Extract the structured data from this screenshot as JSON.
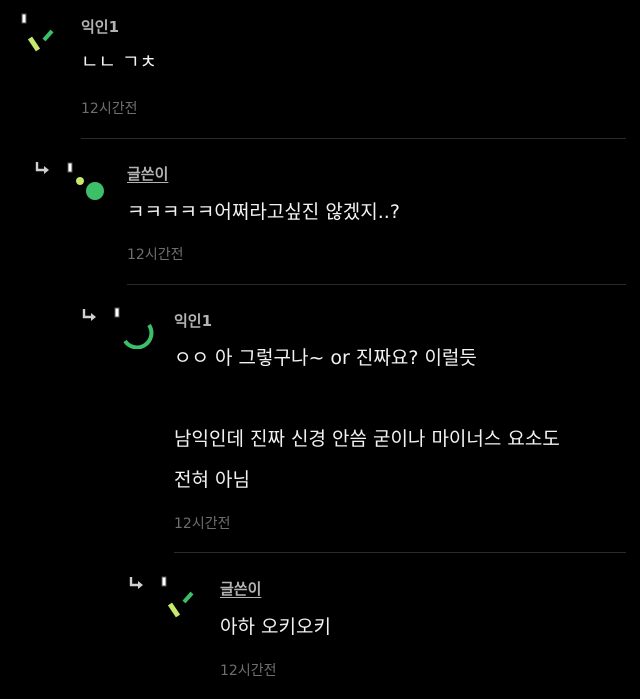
{
  "colors": {
    "background": "#000000",
    "author": "#b3b3b3",
    "body_text": "#f2f2f2",
    "timestamp": "#6e6e6e",
    "divider": "#2a2a2a",
    "avatar_green_light": "#c6e86b",
    "avatar_green": "#3dbf6a"
  },
  "comments": [
    {
      "author": "익인1",
      "body": "ㄴㄴ ㄱㅊ",
      "time": "12시간전",
      "avatar_icon": "slash-shapes-avatar-icon"
    },
    {
      "author": "글쓴이",
      "body": "ㅋㅋㅋㅋㅋ어쩌라고싶진 않겠지..?",
      "time": "12시간전",
      "avatar_icon": "dots-avatar-icon"
    },
    {
      "author": "익인1",
      "body_lines": [
        "ㅇㅇ 아 그렇구나~ or 진짜요? 이럴듯",
        "",
        "남익인데 진짜 신경 안씀 굳이나 마이너스 요소도",
        "전혀 아님"
      ],
      "time": "12시간전",
      "avatar_icon": "arc-avatar-icon"
    },
    {
      "author": "글쓴이",
      "body": "아하 오키오키",
      "time": "12시간전",
      "avatar_icon": "slash-shapes-avatar-icon"
    }
  ]
}
